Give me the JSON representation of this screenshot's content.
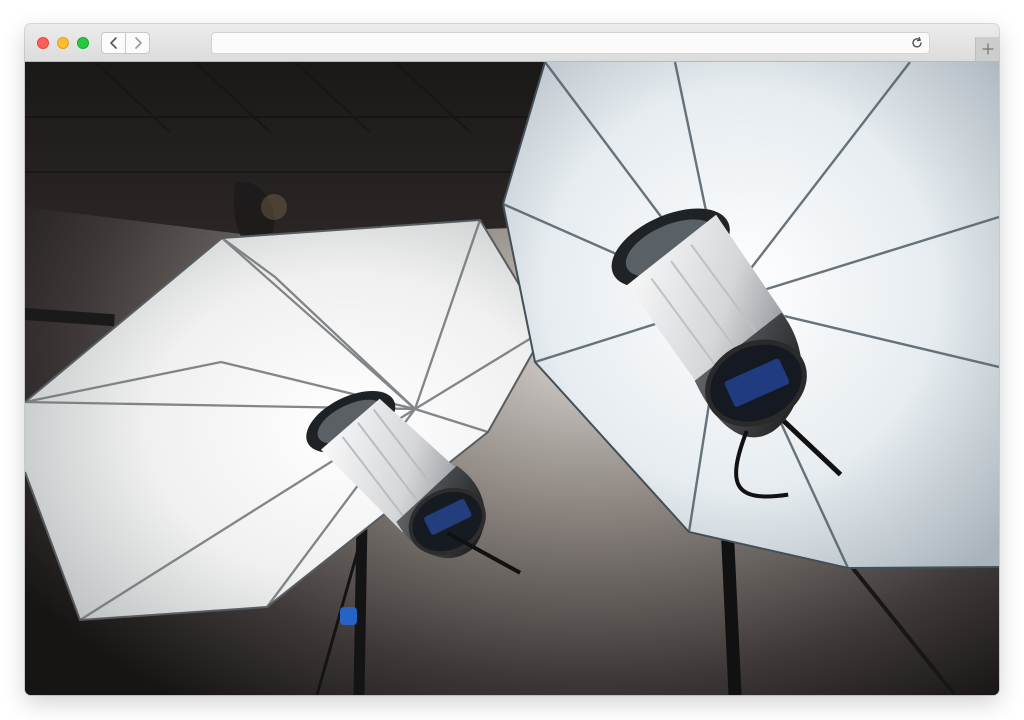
{
  "browser": {
    "address": "",
    "controls": {
      "close": "close-window",
      "minimize": "minimize-window",
      "zoom": "zoom-window",
      "back": "chevron-left-icon",
      "forward": "chevron-right-icon",
      "reload": "reload-icon",
      "new_tab": "plus-icon"
    }
  },
  "content": {
    "image": "photo-studio-umbrella-lights"
  },
  "colors": {
    "chrome": "#e6e6e6",
    "umbrella": "#f2f2f2",
    "background": "#1e1b1b"
  }
}
